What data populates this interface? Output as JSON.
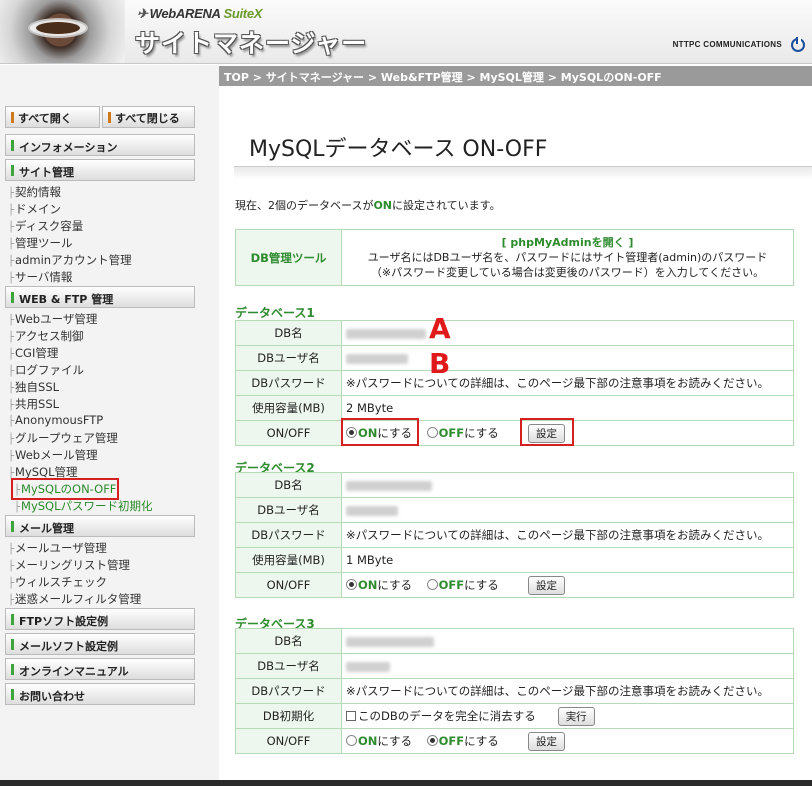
{
  "header": {
    "brand": "WebARENA",
    "brand_suite": "SuiteX",
    "app_title": "サイトマネージャー",
    "company": "NTTPC COMMUNICATIONS"
  },
  "breadcrumb": "TOP > サイトマネージャー > Web&FTP管理 > MySQL管理 > MySQLのON-OFF",
  "sidebar": {
    "open_all": "すべて開く",
    "close_all": "すべて閉じる",
    "info": "インフォメーション",
    "site_mgmt": "サイト管理",
    "site_items": [
      "契約情報",
      "ドメイン",
      "ディスク容量",
      "管理ツール",
      "adminアカウント管理",
      "サーバ情報"
    ],
    "web_ftp": "WEB & FTP 管理",
    "web_items": [
      "Webユーザ管理",
      "アクセス制御",
      "CGI管理",
      "ログファイル",
      "独自SSL",
      "共用SSL",
      "AnonymousFTP",
      "グループウェア管理",
      "Webメール管理",
      "MySQL管理"
    ],
    "mysql_children": [
      "MySQLのON-OFF",
      "MySQLパスワード初期化"
    ],
    "mail_mgmt": "メール管理",
    "mail_items": [
      "メールユーザ管理",
      "メーリングリスト管理",
      "ウィルスチェック",
      "迷惑メールフィルタ管理"
    ],
    "ftp_soft": "FTPソフト設定例",
    "mail_soft": "メールソフト設定例",
    "manual": "オンラインマニュアル",
    "contact": "お問い合わせ"
  },
  "main": {
    "title": "MySQLデータベース ON-OFF",
    "status_pre": "現在、2個のデータベースが",
    "status_on": "ON",
    "status_post": "に設定されています。",
    "tool_label": "DB管理ツール",
    "tool_link": "[ phpMyAdminを開く ]",
    "tool_line1": "ユーザ名にはDBユーザ名を、パスワードにはサイト管理者(admin)のパスワード",
    "tool_line2": "（※パスワード変更している場合は変更後のパスワード）を入力してください。"
  },
  "labels": {
    "db_name": "DB名",
    "db_user": "DBユーザ名",
    "db_pass": "DBパスワード",
    "usage": "使用容量(MB)",
    "onoff": "ON/OFF",
    "init": "DB初期化",
    "pass_note": "※パスワードについての詳細は、このページ最下部の注意事項をお読みください。",
    "on_label": "ON",
    "on_suffix": "にする",
    "off_label": "OFF",
    "off_suffix": "にする",
    "set_button": "設定",
    "init_check": "このDBのデータを完全に消去する",
    "exec_button": "実行"
  },
  "databases": [
    {
      "heading": "データベース1",
      "usage": "2 MByte",
      "state": "on"
    },
    {
      "heading": "データベース2",
      "usage": "1 MByte",
      "state": "on"
    },
    {
      "heading": "データベース3",
      "state": "off"
    }
  ],
  "annotations": {
    "a": "A",
    "b": "B"
  },
  "colors": {
    "accent_green": "#2e8b2e",
    "highlight_red": "#d42020",
    "breadcrumb_bg": "#9a9a9a"
  }
}
